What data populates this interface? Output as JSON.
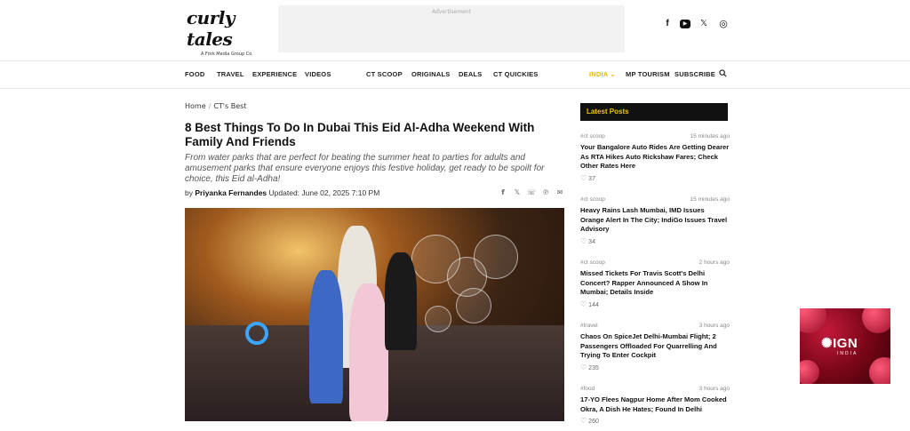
{
  "header": {
    "logo_text": "curly tales",
    "logo_tagline": "A Fork Media Group Co.",
    "ad_label": "Advertisement",
    "social": [
      "f",
      "▶",
      "𝕏",
      "◎"
    ]
  },
  "nav": {
    "items": [
      "FOOD",
      "TRAVEL",
      "EXPERIENCE",
      "VIDEOS",
      "CT SCOOP",
      "ORIGINALS",
      "DEALS",
      "CT QUICKIES"
    ],
    "region": "INDIA ⌄",
    "right_items": [
      "MP TOURISM",
      "SUBSCRIBE"
    ]
  },
  "breadcrumb": {
    "home": "Home",
    "sep": "/",
    "current": "CT's Best"
  },
  "article": {
    "title": "8 Best Things To Do In Dubai This Eid Al-Adha Weekend With Family And Friends",
    "dek": "From water parks that are perfect for beating the summer heat to parties for adults and amusement parks that ensure everyone enjoys this festive holiday, get ready to be spoilt for choice, this Eid al-Adha!",
    "by": "by",
    "author": "Priyanka Fernandes",
    "updated": "Updated: June 02, 2025 7:10 PM",
    "share_icons": [
      "f",
      "𝕏",
      "☏",
      "℗",
      "✉"
    ]
  },
  "sidebar": {
    "heading": "Latest Posts",
    "posts": [
      {
        "tag": "#ct scoop",
        "time": "15 minutes ago",
        "title": "Your Bangalore Auto Rides Are Getting Dearer As RTA Hikes Auto Rickshaw Fares; Check Other Rates Here",
        "likes": "37"
      },
      {
        "tag": "#ct scoop",
        "time": "15 minutes ago",
        "title": "Heavy Rains Lash Mumbai, IMD Issues Orange Alert In The City; IndiGo Issues Travel Advisory",
        "likes": "34"
      },
      {
        "tag": "#ct scoop",
        "time": "2 hours ago",
        "title": "Missed Tickets For Travis Scott's Delhi Concert? Rapper Announced A Show In Mumbai; Details Inside",
        "likes": "144"
      },
      {
        "tag": "#travel",
        "time": "3 hours ago",
        "title": "Chaos On SpiceJet Delhi-Mumbai Flight; 2 Passengers Offloaded For Quarrelling And Trying To Enter Cockpit",
        "likes": "235"
      },
      {
        "tag": "#food",
        "time": "3 hours ago",
        "title": "17-YO Flees Nagpur Home After Mom Cooked Okra, A Dish He Hates; Found In Delhi",
        "likes": "260"
      }
    ]
  },
  "ad_side": {
    "brand": "IGN",
    "sub": "INDIA"
  },
  "colors": {
    "accent": "#f5c400",
    "nav_highlight": "#e6b800",
    "dark": "#111111"
  }
}
